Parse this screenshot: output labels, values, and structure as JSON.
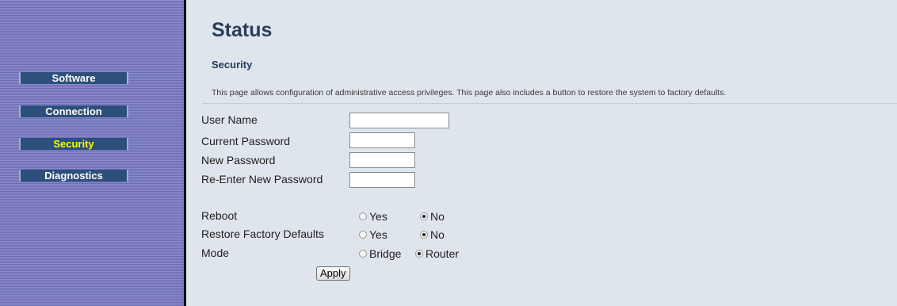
{
  "sidebar": {
    "items": [
      {
        "label": "Software",
        "active": false
      },
      {
        "label": "Connection",
        "active": false
      },
      {
        "label": "Security",
        "active": true
      },
      {
        "label": "Diagnostics",
        "active": false
      }
    ]
  },
  "main": {
    "title": "Status",
    "section": "Security",
    "description": "This page allows configuration of administrative access privileges. This page also includes a button to restore the system to factory defaults."
  },
  "form": {
    "user_name_label": "User Name",
    "user_name_value": "",
    "current_password_label": "Current Password",
    "current_password_value": "",
    "new_password_label": "New Password",
    "new_password_value": "",
    "reenter_password_label": "Re-Enter New Password",
    "reenter_password_value": "",
    "reboot": {
      "label": "Reboot",
      "options": [
        "Yes",
        "No"
      ],
      "selected": "No"
    },
    "restore_defaults": {
      "label": "Restore Factory Defaults",
      "options": [
        "Yes",
        "No"
      ],
      "selected": "No"
    },
    "mode": {
      "label": "Mode",
      "options": [
        "Bridge",
        "Router"
      ],
      "selected": "Router"
    },
    "apply_label": "Apply"
  },
  "colors": {
    "sidebar_bg": "#7f7fc1",
    "nav_button": "#2d4f7b",
    "active_text": "#ffff00",
    "main_bg": "#dfe5ec",
    "title_text": "#2a3d5c"
  }
}
